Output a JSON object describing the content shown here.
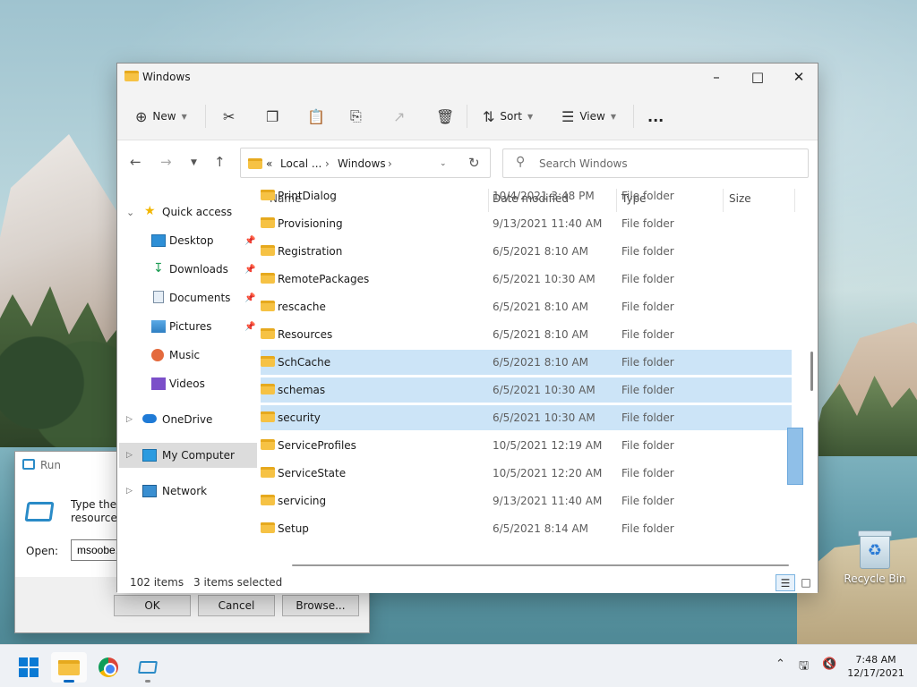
{
  "desktop": {
    "recycle_bin_label": "Recycle Bin"
  },
  "run_dialog": {
    "title": "Run",
    "description": "Type the n\nresource,",
    "open_label": "Open:",
    "open_value": "msoobe.",
    "ok_label": "OK",
    "cancel_label": "Cancel",
    "browse_label": "Browse..."
  },
  "explorer": {
    "title": "Windows",
    "toolbar": {
      "new_label": "New",
      "sort_label": "Sort",
      "view_label": "View",
      "more_label": "..."
    },
    "address": {
      "overflow": "«",
      "segments": [
        "Local ...",
        "Windows"
      ]
    },
    "search_placeholder": "Search Windows",
    "nav": {
      "quick_access": "Quick access",
      "desktop": "Desktop",
      "downloads": "Downloads",
      "documents": "Documents",
      "pictures": "Pictures",
      "music": "Music",
      "videos": "Videos",
      "onedrive": "OneDrive",
      "my_computer": "My Computer",
      "network": "Network"
    },
    "columns": {
      "name": "Name",
      "date_modified": "Date modified",
      "type": "Type",
      "size": "Size"
    },
    "rows": [
      {
        "name": "PrintDialog",
        "date": "10/4/2021 3:48 PM",
        "type": "File folder",
        "selected": false
      },
      {
        "name": "Provisioning",
        "date": "9/13/2021 11:40 AM",
        "type": "File folder",
        "selected": false
      },
      {
        "name": "Registration",
        "date": "6/5/2021 8:10 AM",
        "type": "File folder",
        "selected": false
      },
      {
        "name": "RemotePackages",
        "date": "6/5/2021 10:30 AM",
        "type": "File folder",
        "selected": false
      },
      {
        "name": "rescache",
        "date": "6/5/2021 8:10 AM",
        "type": "File folder",
        "selected": false
      },
      {
        "name": "Resources",
        "date": "6/5/2021 8:10 AM",
        "type": "File folder",
        "selected": false
      },
      {
        "name": "SchCache",
        "date": "6/5/2021 8:10 AM",
        "type": "File folder",
        "selected": true
      },
      {
        "name": "schemas",
        "date": "6/5/2021 10:30 AM",
        "type": "File folder",
        "selected": true
      },
      {
        "name": "security",
        "date": "6/5/2021 10:30 AM",
        "type": "File folder",
        "selected": true
      },
      {
        "name": "ServiceProfiles",
        "date": "10/5/2021 12:19 AM",
        "type": "File folder",
        "selected": false
      },
      {
        "name": "ServiceState",
        "date": "10/5/2021 12:20 AM",
        "type": "File folder",
        "selected": false
      },
      {
        "name": "servicing",
        "date": "9/13/2021 11:40 AM",
        "type": "File folder",
        "selected": false
      },
      {
        "name": "Setup",
        "date": "6/5/2021 8:14 AM",
        "type": "File folder",
        "selected": false
      }
    ],
    "status": {
      "item_count": "102 items",
      "selected_count": "3 items selected"
    }
  },
  "taskbar": {
    "time": "7:48 AM",
    "date": "12/17/2021"
  },
  "colors": {
    "accent": "#0067c0",
    "selection": "#cce4f7",
    "folder": "#f6c244"
  }
}
